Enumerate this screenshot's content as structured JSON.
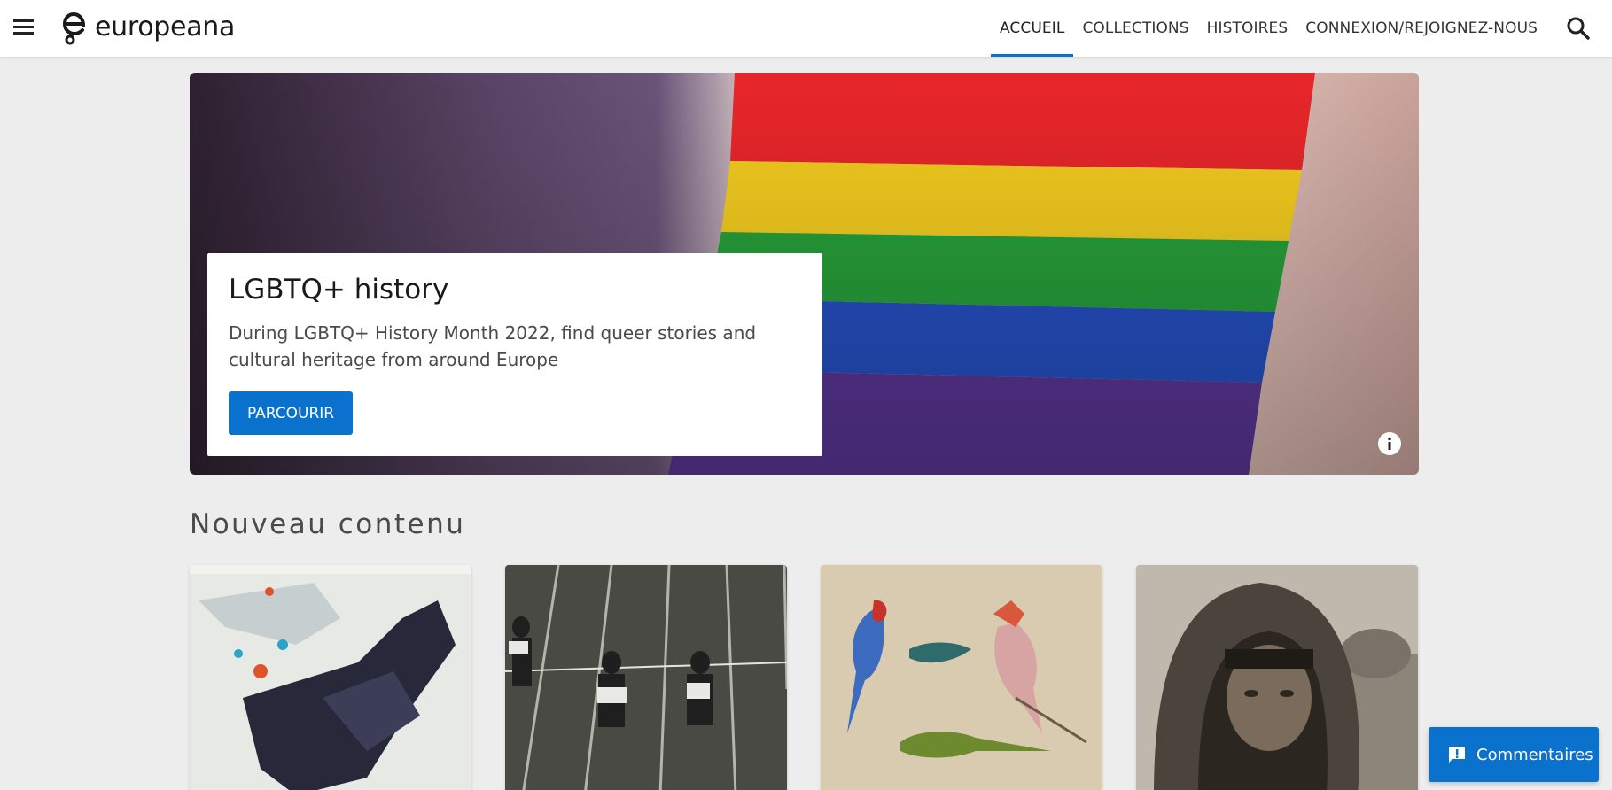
{
  "header": {
    "logo_text": "europeana",
    "nav": [
      {
        "label": "ACCUEIL",
        "active": true
      },
      {
        "label": "COLLECTIONS",
        "active": false
      },
      {
        "label": "HISTOIRES",
        "active": false
      },
      {
        "label": "CONNEXION/REJOIGNEZ-NOUS",
        "active": false
      }
    ]
  },
  "hero": {
    "title": "LGBTQ+ history",
    "description": "During LGBTQ+ History Month 2022, find queer stories and cultural heritage from around Europe",
    "button_label": "PARCOURIR"
  },
  "section": {
    "title": "Nouveau contenu"
  },
  "feedback": {
    "label": "Commentaires"
  },
  "colors": {
    "accent": "#0a72cc",
    "background": "#ededed"
  }
}
